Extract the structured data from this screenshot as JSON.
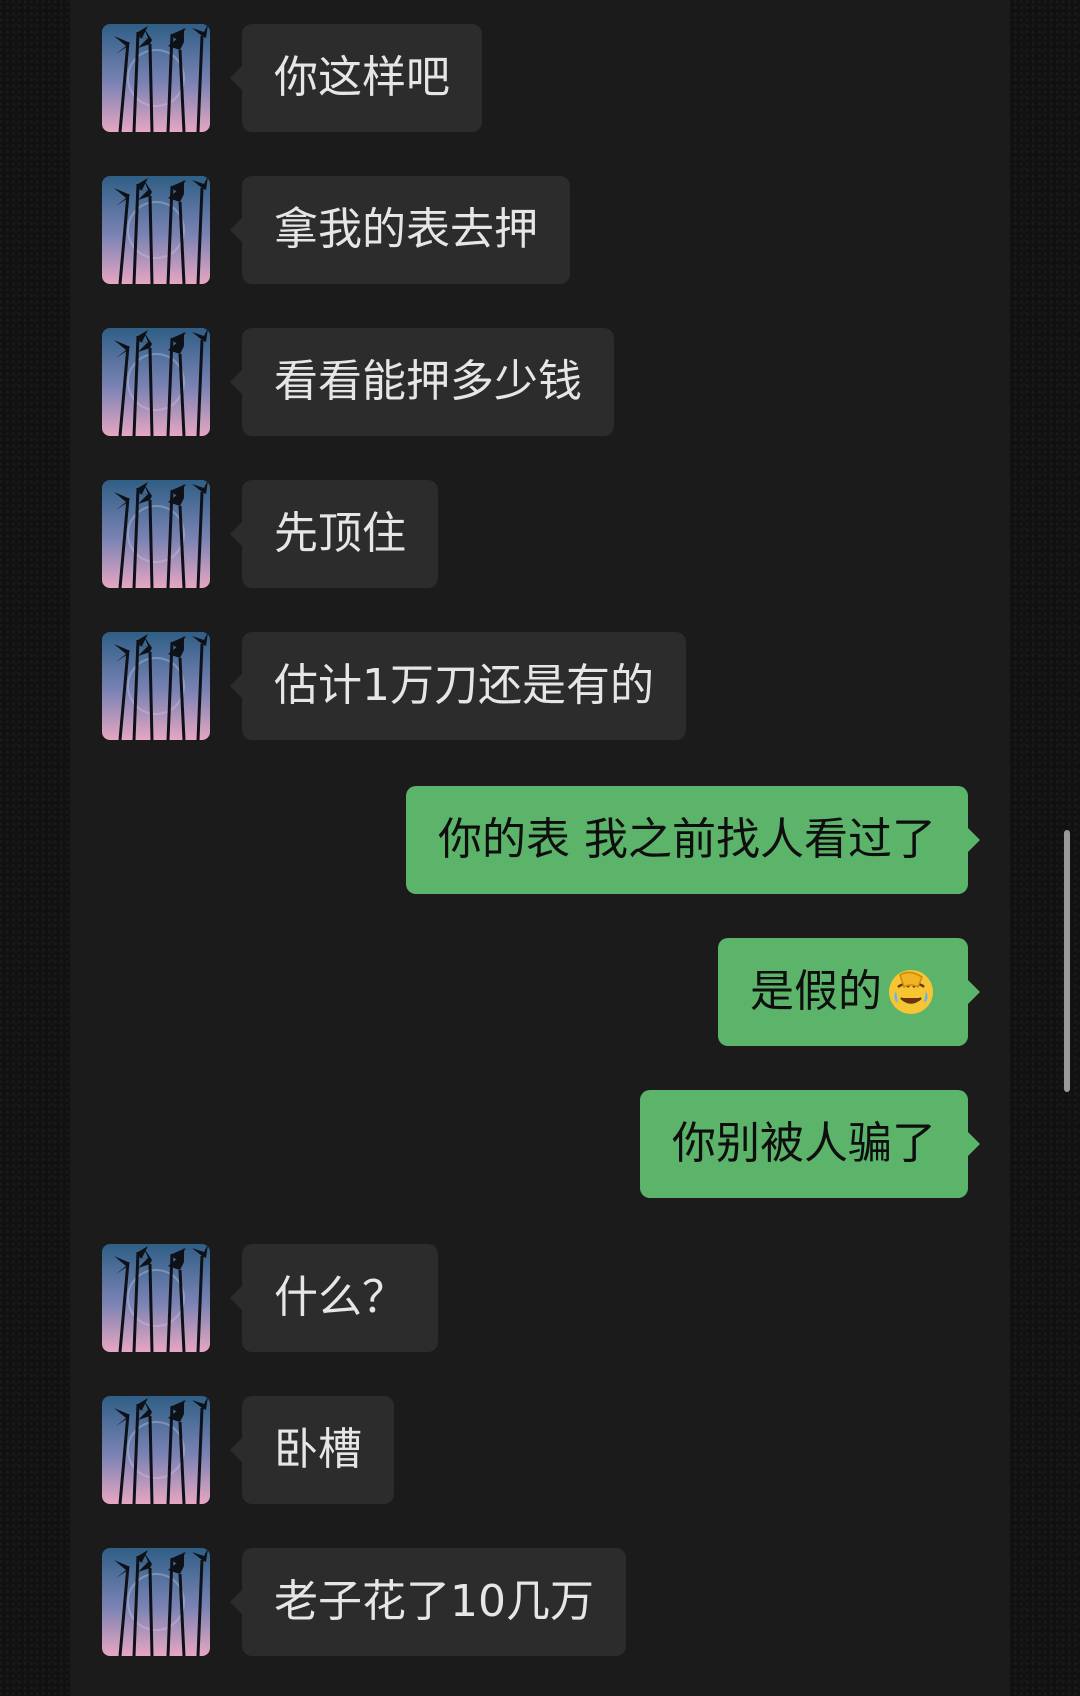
{
  "messages": [
    {
      "side": "in",
      "text": "你这样吧"
    },
    {
      "side": "in",
      "text": "拿我的表去押"
    },
    {
      "side": "in",
      "text": "看看能押多少钱"
    },
    {
      "side": "in",
      "text": "先顶住"
    },
    {
      "side": "in",
      "text": "估计1万刀还是有的"
    },
    {
      "side": "out",
      "text": "你的表 我之前找人看过了"
    },
    {
      "side": "out",
      "text": "是假的",
      "emoji": "face-palm-crying-emoji"
    },
    {
      "side": "out",
      "text": "你别被人骗了"
    },
    {
      "side": "in",
      "text": "什么？"
    },
    {
      "side": "in",
      "text": "卧槽"
    },
    {
      "side": "in",
      "text": "老子花了10几万"
    }
  ],
  "colors": {
    "incoming_bubble": "#2c2c2c",
    "outgoing_bubble": "#5bb46a",
    "chat_background": "#1b1b1b"
  }
}
